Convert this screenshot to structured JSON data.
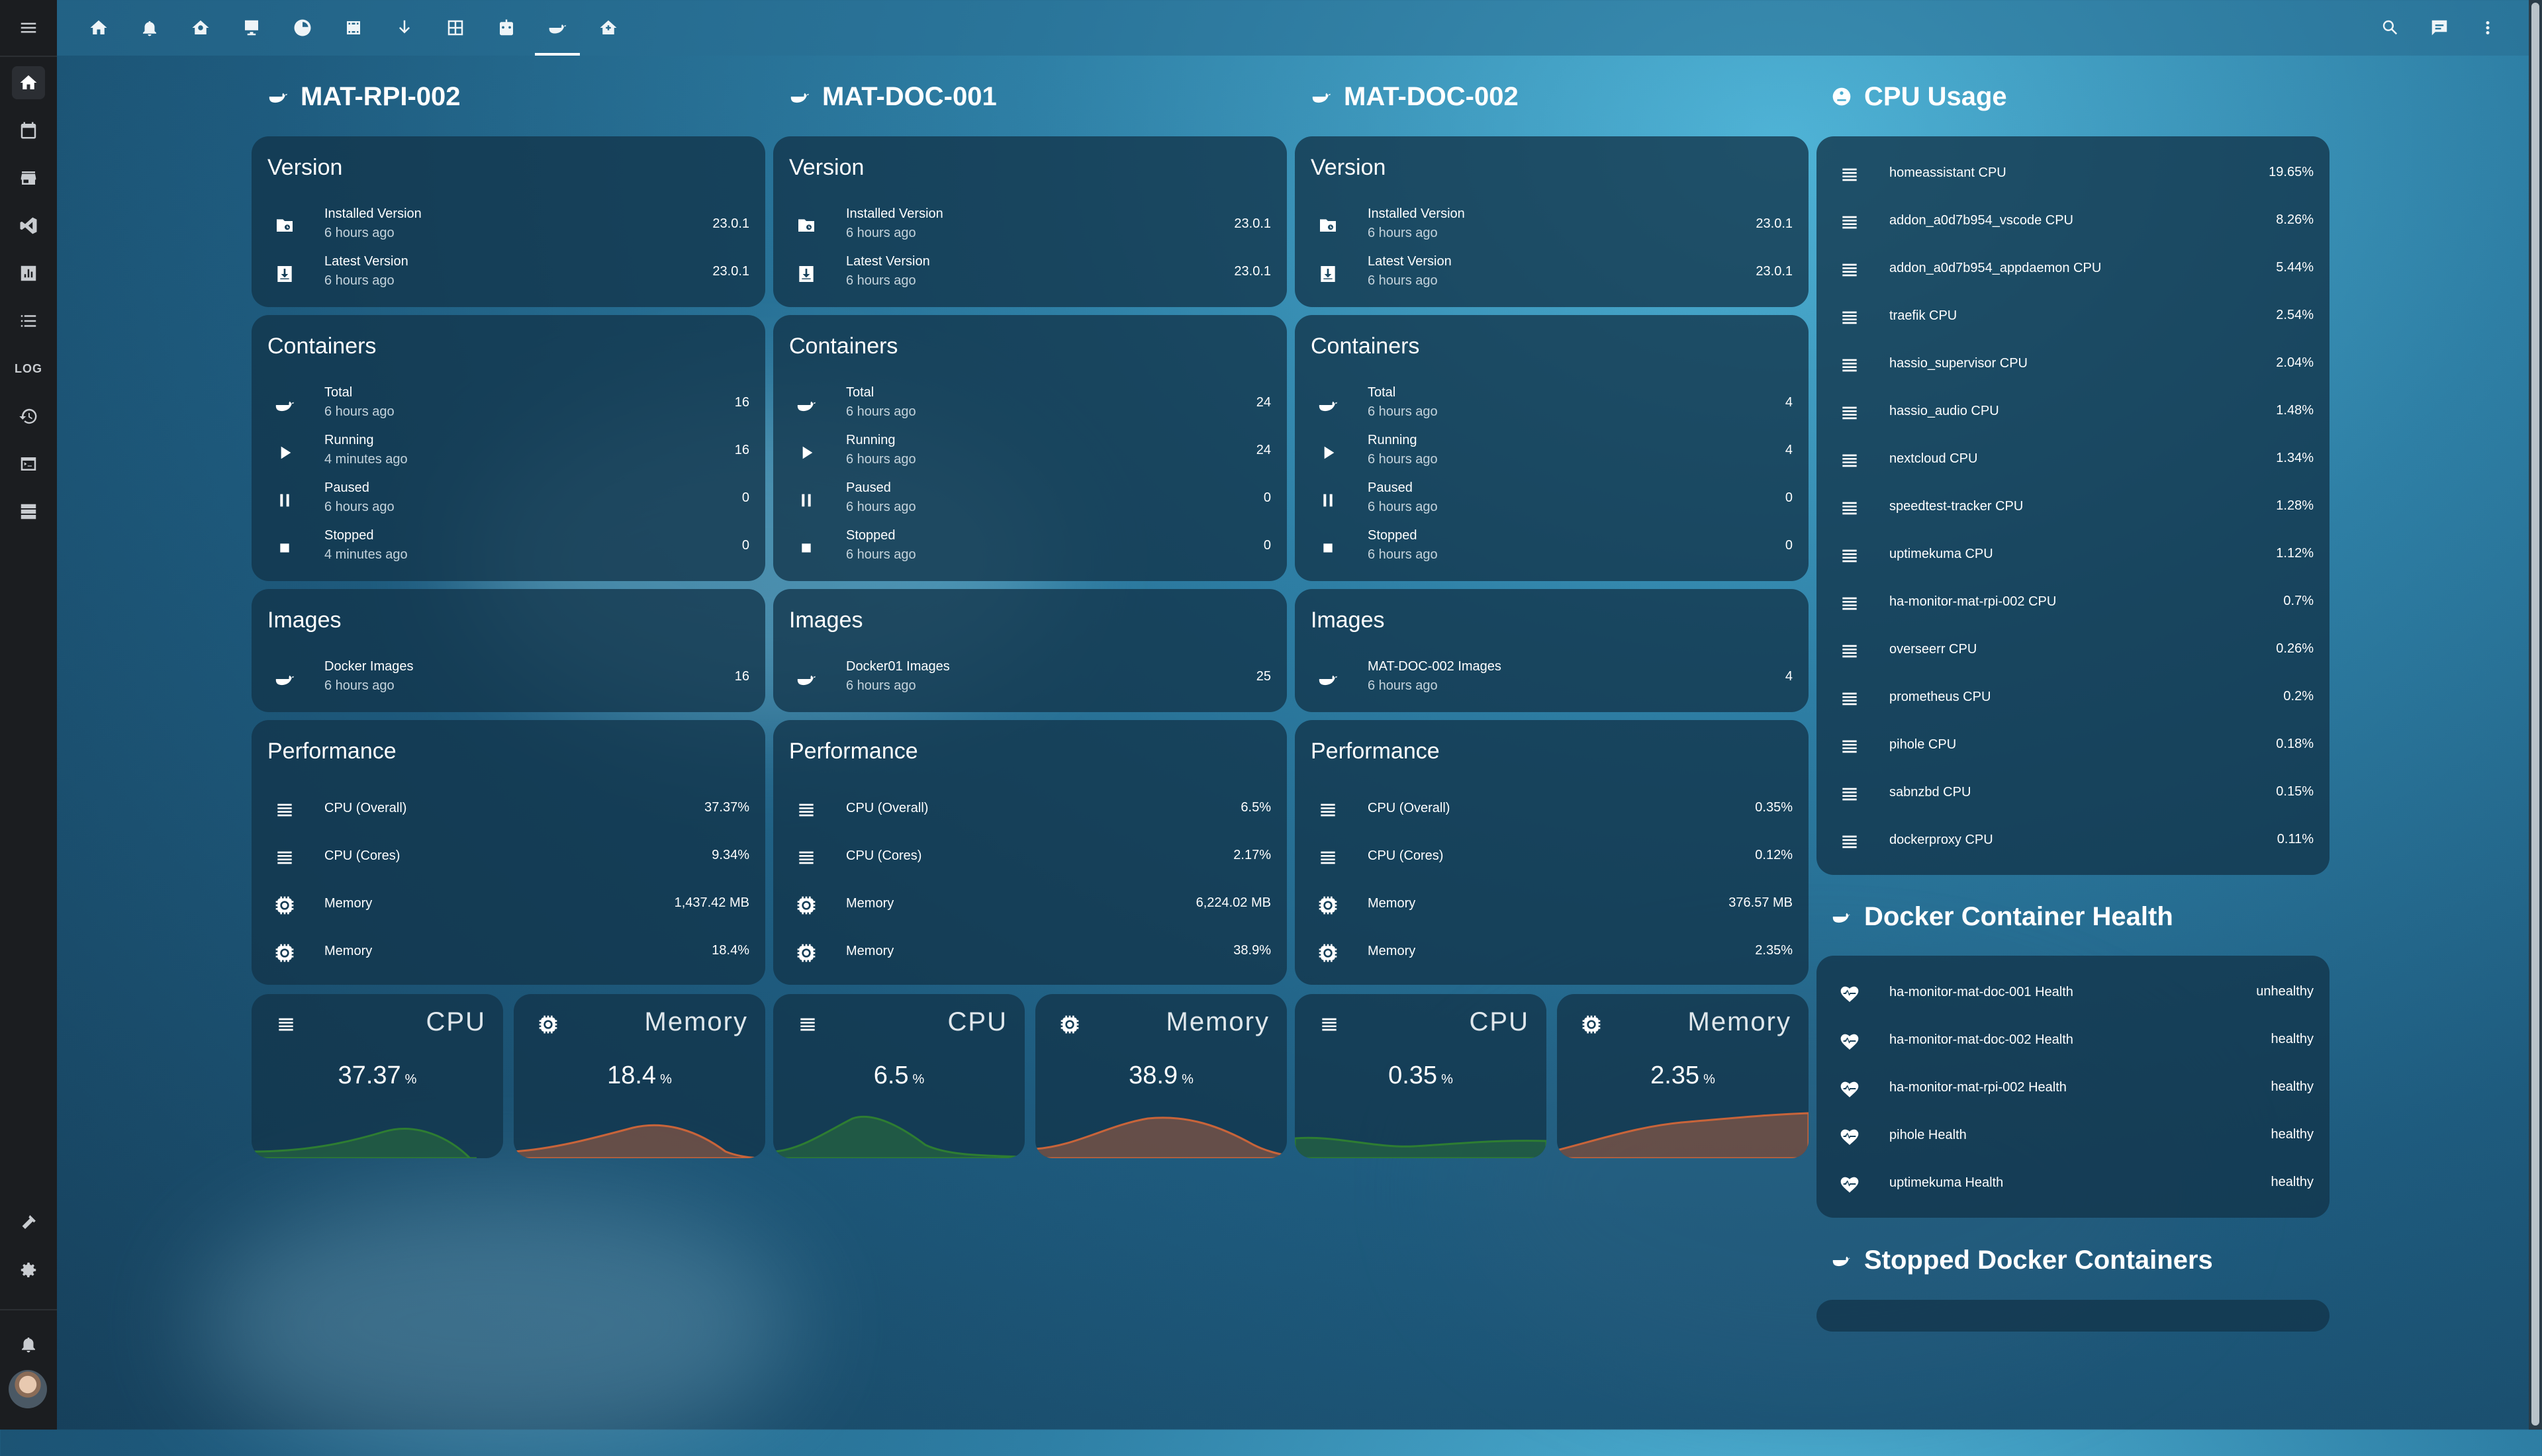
{
  "colors": {
    "cpu_graph": "#2e7d32",
    "memory_graph": "#c8643a"
  },
  "servers": [
    {
      "title": "MAT-RPI-002",
      "version": {
        "title": "Version",
        "installed": {
          "label": "Installed Version",
          "time": "6 hours ago",
          "value": "23.0.1"
        },
        "latest": {
          "label": "Latest Version",
          "time": "6 hours ago",
          "value": "23.0.1"
        }
      },
      "containers": {
        "title": "Containers",
        "total": {
          "label": "Total",
          "time": "6 hours ago",
          "value": "16"
        },
        "running": {
          "label": "Running",
          "time": "4 minutes ago",
          "value": "16"
        },
        "paused": {
          "label": "Paused",
          "time": "6 hours ago",
          "value": "0"
        },
        "stopped": {
          "label": "Stopped",
          "time": "4 minutes ago",
          "value": "0"
        }
      },
      "images": {
        "title": "Images",
        "label": "Docker Images",
        "time": "6 hours ago",
        "value": "16"
      },
      "performance": {
        "title": "Performance",
        "cpu_overall": {
          "label": "CPU (Overall)",
          "value": "37.37%"
        },
        "cpu_cores": {
          "label": "CPU (Cores)",
          "value": "9.34%"
        },
        "memory_mb": {
          "label": "Memory",
          "value": "1,437.42 MB"
        },
        "memory_pct": {
          "label": "Memory",
          "value": "18.4%"
        }
      },
      "gauges": {
        "cpu": {
          "name": "CPU",
          "value": "37.37",
          "unit": "%"
        },
        "memory": {
          "name": "Memory",
          "value": "18.4",
          "unit": "%"
        }
      }
    },
    {
      "title": "MAT-DOC-001",
      "version": {
        "title": "Version",
        "installed": {
          "label": "Installed Version",
          "time": "6 hours ago",
          "value": "23.0.1"
        },
        "latest": {
          "label": "Latest Version",
          "time": "6 hours ago",
          "value": "23.0.1"
        }
      },
      "containers": {
        "title": "Containers",
        "total": {
          "label": "Total",
          "time": "6 hours ago",
          "value": "24"
        },
        "running": {
          "label": "Running",
          "time": "6 hours ago",
          "value": "24"
        },
        "paused": {
          "label": "Paused",
          "time": "6 hours ago",
          "value": "0"
        },
        "stopped": {
          "label": "Stopped",
          "time": "6 hours ago",
          "value": "0"
        }
      },
      "images": {
        "title": "Images",
        "label": "Docker01 Images",
        "time": "6 hours ago",
        "value": "25"
      },
      "performance": {
        "title": "Performance",
        "cpu_overall": {
          "label": "CPU (Overall)",
          "value": "6.5%"
        },
        "cpu_cores": {
          "label": "CPU (Cores)",
          "value": "2.17%"
        },
        "memory_mb": {
          "label": "Memory",
          "value": "6,224.02 MB"
        },
        "memory_pct": {
          "label": "Memory",
          "value": "38.9%"
        }
      },
      "gauges": {
        "cpu": {
          "name": "CPU",
          "value": "6.5",
          "unit": "%"
        },
        "memory": {
          "name": "Memory",
          "value": "38.9",
          "unit": "%"
        }
      }
    },
    {
      "title": "MAT-DOC-002",
      "version": {
        "title": "Version",
        "installed": {
          "label": "Installed Version",
          "time": "6 hours ago",
          "value": "23.0.1"
        },
        "latest": {
          "label": "Latest Version",
          "time": "6 hours ago",
          "value": "23.0.1"
        }
      },
      "containers": {
        "title": "Containers",
        "total": {
          "label": "Total",
          "time": "6 hours ago",
          "value": "4"
        },
        "running": {
          "label": "Running",
          "time": "6 hours ago",
          "value": "4"
        },
        "paused": {
          "label": "Paused",
          "time": "6 hours ago",
          "value": "0"
        },
        "stopped": {
          "label": "Stopped",
          "time": "6 hours ago",
          "value": "0"
        }
      },
      "images": {
        "title": "Images",
        "label": "MAT-DOC-002 Images",
        "time": "6 hours ago",
        "value": "4"
      },
      "performance": {
        "title": "Performance",
        "cpu_overall": {
          "label": "CPU (Overall)",
          "value": "0.35%"
        },
        "cpu_cores": {
          "label": "CPU (Cores)",
          "value": "0.12%"
        },
        "memory_mb": {
          "label": "Memory",
          "value": "376.57 MB"
        },
        "memory_pct": {
          "label": "Memory",
          "value": "2.35%"
        }
      },
      "gauges": {
        "cpu": {
          "name": "CPU",
          "value": "0.35",
          "unit": "%"
        },
        "memory": {
          "name": "Memory",
          "value": "2.35",
          "unit": "%"
        }
      }
    }
  ],
  "cpu_usage": {
    "title": "CPU Usage",
    "items": [
      {
        "label": "homeassistant CPU",
        "value": "19.65%"
      },
      {
        "label": "addon_a0d7b954_vscode CPU",
        "value": "8.26%"
      },
      {
        "label": "addon_a0d7b954_appdaemon CPU",
        "value": "5.44%"
      },
      {
        "label": "traefik CPU",
        "value": "2.54%"
      },
      {
        "label": "hassio_supervisor CPU",
        "value": "2.04%"
      },
      {
        "label": "hassio_audio CPU",
        "value": "1.48%"
      },
      {
        "label": "nextcloud CPU",
        "value": "1.34%"
      },
      {
        "label": "speedtest-tracker CPU",
        "value": "1.28%"
      },
      {
        "label": "uptimekuma CPU",
        "value": "1.12%"
      },
      {
        "label": "ha-monitor-mat-rpi-002 CPU",
        "value": "0.7%"
      },
      {
        "label": "overseerr CPU",
        "value": "0.26%"
      },
      {
        "label": "prometheus CPU",
        "value": "0.2%"
      },
      {
        "label": "pihole CPU",
        "value": "0.18%"
      },
      {
        "label": "sabnzbd CPU",
        "value": "0.15%"
      },
      {
        "label": "dockerproxy CPU",
        "value": "0.11%"
      }
    ]
  },
  "health": {
    "title": "Docker Container Health",
    "items": [
      {
        "label": "ha-monitor-mat-doc-001 Health",
        "value": "unhealthy"
      },
      {
        "label": "ha-monitor-mat-doc-002 Health",
        "value": "healthy"
      },
      {
        "label": "ha-monitor-mat-rpi-002 Health",
        "value": "healthy"
      },
      {
        "label": "pihole Health",
        "value": "healthy"
      },
      {
        "label": "uptimekuma Health",
        "value": "healthy"
      }
    ]
  },
  "stopped": {
    "title": "Stopped Docker Containers"
  },
  "sidebar": {
    "log_label": "LOG"
  }
}
